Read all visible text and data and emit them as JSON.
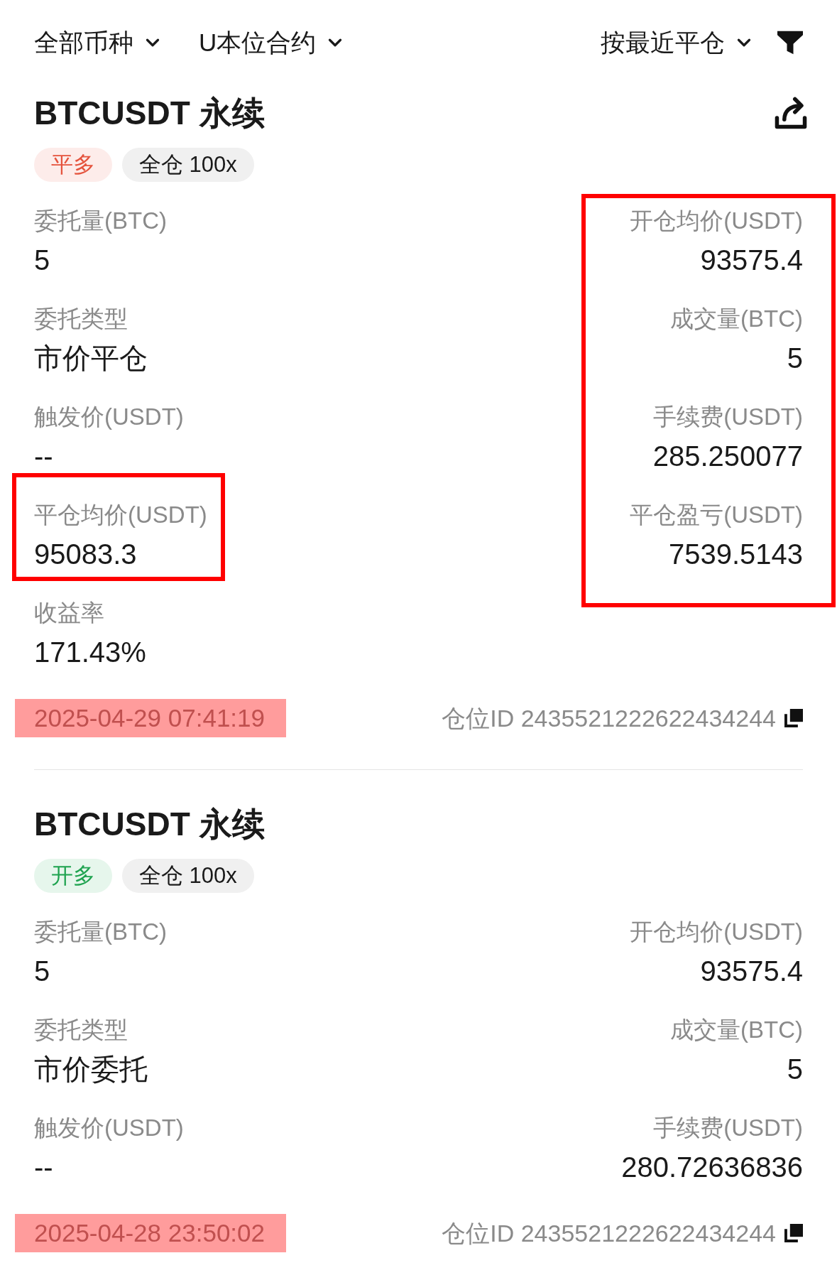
{
  "filters": [
    {
      "label": "全部币种"
    },
    {
      "label": "U本位合约"
    }
  ],
  "sort": {
    "label": "按最近平仓"
  },
  "cards": [
    {
      "title": "BTCUSDT 永续",
      "share": true,
      "tags": [
        {
          "label": "平多",
          "kind": "close"
        },
        {
          "label": "全仓 100x",
          "kind": "margin"
        }
      ],
      "left_fields": [
        {
          "label": "委托量(BTC)",
          "value": "5",
          "boxed": false
        },
        {
          "label": "委托类型",
          "value": "市价平仓",
          "boxed": false
        },
        {
          "label": "触发价(USDT)",
          "value": "--",
          "boxed": false
        },
        {
          "label": "平仓均价(USDT)",
          "value": "95083.3",
          "boxed": true
        },
        {
          "label": "收益率",
          "value": "171.43%",
          "boxed": false
        }
      ],
      "right_boxed": true,
      "right_fields": [
        {
          "label": "开仓均价(USDT)",
          "value": "93575.4"
        },
        {
          "label": "成交量(BTC)",
          "value": "5"
        },
        {
          "label": "手续费(USDT)",
          "value": "285.250077"
        },
        {
          "label": "平仓盈亏(USDT)",
          "value": "7539.5143"
        }
      ],
      "time": {
        "text": "2025-04-29 07:41:19",
        "highlighted": true
      },
      "position_id": "仓位ID 2435521222622434244"
    },
    {
      "title": "BTCUSDT 永续",
      "share": false,
      "tags": [
        {
          "label": "开多",
          "kind": "open"
        },
        {
          "label": "全仓 100x",
          "kind": "margin"
        }
      ],
      "left_fields": [
        {
          "label": "委托量(BTC)",
          "value": "5",
          "boxed": false
        },
        {
          "label": "委托类型",
          "value": "市价委托",
          "boxed": false
        },
        {
          "label": "触发价(USDT)",
          "value": "--",
          "boxed": false
        }
      ],
      "right_boxed": false,
      "right_fields": [
        {
          "label": "开仓均价(USDT)",
          "value": "93575.4"
        },
        {
          "label": "成交量(BTC)",
          "value": "5"
        },
        {
          "label": "手续费(USDT)",
          "value": "280.72636836"
        }
      ],
      "time": {
        "text": "2025-04-28 23:50:02",
        "highlighted": true
      },
      "position_id": "仓位ID 2435521222622434244"
    }
  ]
}
